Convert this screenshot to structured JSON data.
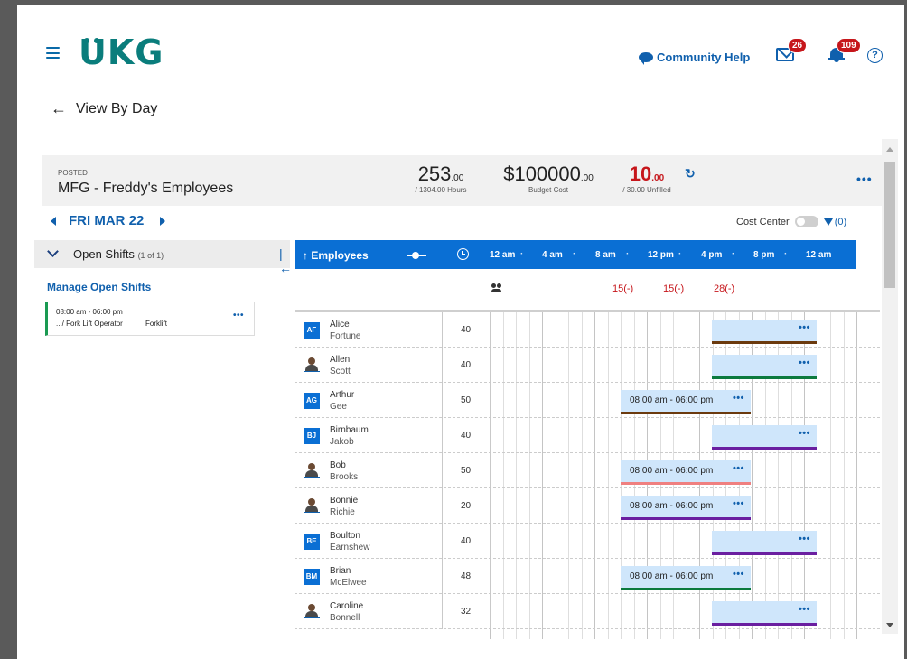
{
  "header": {
    "logo": "UKG",
    "community_help": "Community Help",
    "mail_count": "26",
    "notif_count": "109",
    "help_glyph": "?"
  },
  "page": {
    "back_label": "View By Day"
  },
  "summary": {
    "status": "POSTED",
    "team": "MFG - Freddy's Employees",
    "hours_value": "253",
    "hours_decimal": ".00",
    "hours_sub": "/ 1304.00 Hours",
    "budget_value": "$100000",
    "budget_decimal": ".00",
    "budget_sub": "Budget Cost",
    "unfilled_value": "10",
    "unfilled_decimal": ".00",
    "unfilled_sub": "/ 30.00 Unfilled"
  },
  "date_nav": {
    "date": "FRI MAR 22",
    "cost_center": "Cost Center",
    "filter_count": "(0)"
  },
  "open_shifts": {
    "title": "Open Shifts",
    "count": "(1 of 1)",
    "manage": "Manage Open Shifts",
    "card_time": "08:00 am - 06:00 pm",
    "card_job": ".../ Fork Lift Operator",
    "card_tag": "Forklift"
  },
  "schedule": {
    "employees_label": "Employees",
    "ticks": [
      "12 am",
      "4 am",
      "8 am",
      "12 pm",
      "4 pm",
      "8 pm",
      "12 am"
    ],
    "coverage": [
      "15(-)",
      "15(-)",
      "28(-)"
    ],
    "rows": [
      {
        "initials": "AF",
        "first": "Alice",
        "last": "Fortune",
        "hours": "40",
        "shift": "",
        "color": "#6b3a0e"
      },
      {
        "initials": "",
        "first": "Allen",
        "last": "Scott",
        "hours": "40",
        "shift": "",
        "color": "#0c7a3e"
      },
      {
        "initials": "AG",
        "first": "Arthur",
        "last": "Gee",
        "hours": "50",
        "shift": "08:00 am - 06:00 pm",
        "color": "#6b3a0e"
      },
      {
        "initials": "BJ",
        "first": "Birnbaum",
        "last": "Jakob",
        "hours": "40",
        "shift": "",
        "color": "#6a1fa0"
      },
      {
        "initials": "",
        "first": "Bob",
        "last": "Brooks",
        "hours": "50",
        "shift": "08:00 am - 06:00 pm",
        "color": "#ef8080"
      },
      {
        "initials": "",
        "first": "Bonnie",
        "last": "Richie",
        "hours": "20",
        "shift": "08:00 am - 06:00 pm",
        "color": "#6a1fa0"
      },
      {
        "initials": "BE",
        "first": "Boulton",
        "last": "Earnshew",
        "hours": "40",
        "shift": "",
        "color": "#6a1fa0"
      },
      {
        "initials": "BM",
        "first": "Brian",
        "last": "McElwee",
        "hours": "48",
        "shift": "08:00 am - 06:00 pm",
        "color": "#0c7a3e"
      },
      {
        "initials": "",
        "first": "Caroline",
        "last": "Bonnell",
        "hours": "32",
        "shift": "",
        "color": "#6a1fa0"
      }
    ]
  },
  "colors": {
    "brand": "#0a7d7c",
    "accent": "#0a6fd4",
    "alert": "#c6161b"
  }
}
